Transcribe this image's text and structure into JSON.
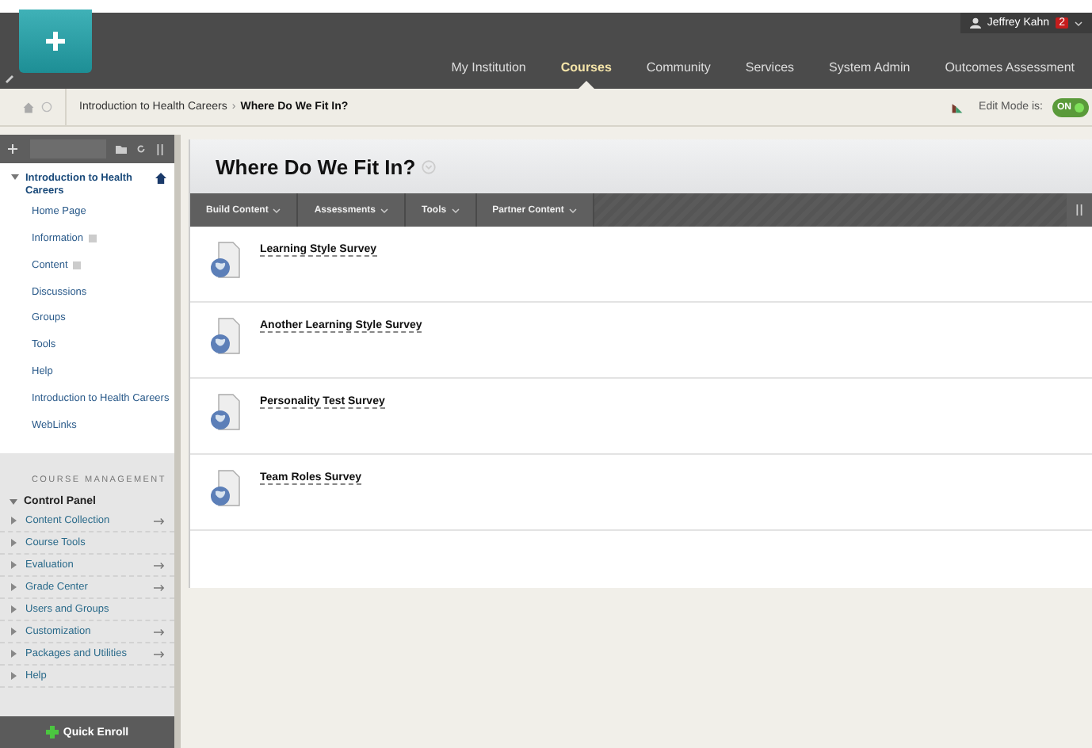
{
  "header": {
    "user": {
      "name": "Jeffrey Kahn",
      "badge": "2"
    },
    "tabs": [
      {
        "label": "My Institution",
        "selected": false
      },
      {
        "label": "Courses",
        "selected": true
      },
      {
        "label": "Community",
        "selected": false
      },
      {
        "label": "Services",
        "selected": false
      },
      {
        "label": "System Admin",
        "selected": false
      },
      {
        "label": "Outcomes Assessment",
        "selected": false
      }
    ]
  },
  "breadcrumb": {
    "items": [
      "Introduction to Health Careers",
      "Where Do We Fit In?"
    ],
    "separator": "›",
    "edit_mode": {
      "label": "Edit Mode is:",
      "value": "ON",
      "on": true
    }
  },
  "course_menu": {
    "title": "Introduction to Health Careers",
    "expanded": true,
    "items": [
      {
        "label": "Home Page",
        "flag": false
      },
      {
        "label": "Information",
        "flag": true
      },
      {
        "label": "Content",
        "flag": true
      },
      {
        "label": "Discussions",
        "flag": false
      },
      {
        "label": "Groups",
        "flag": false
      },
      {
        "label": "Tools",
        "flag": false
      },
      {
        "label": "Help",
        "flag": false
      },
      {
        "label": "Introduction to Health Careers",
        "flag": false
      },
      {
        "label": "WebLinks",
        "flag": false
      }
    ]
  },
  "course_management": {
    "heading": "COURSE MANAGEMENT",
    "control_panel": {
      "label": "Control Panel",
      "expanded": true
    },
    "items": [
      {
        "label": "Content Collection",
        "arrow": true
      },
      {
        "label": "Course Tools",
        "arrow": false
      },
      {
        "label": "Evaluation",
        "arrow": true
      },
      {
        "label": "Grade Center",
        "arrow": true
      },
      {
        "label": "Users and Groups",
        "arrow": false
      },
      {
        "label": "Customization",
        "arrow": true
      },
      {
        "label": "Packages and Utilities",
        "arrow": true
      },
      {
        "label": "Help",
        "arrow": false
      }
    ]
  },
  "quick_enroll": "Quick Enroll",
  "content": {
    "title": "Where Do We Fit In?",
    "action_bar": [
      "Build Content",
      "Assessments",
      "Tools",
      "Partner Content"
    ],
    "items": [
      {
        "title": "Learning Style Survey"
      },
      {
        "title": "Another Learning Style Survey"
      },
      {
        "title": "Personality Test Survey"
      },
      {
        "title": "Team Roles Survey"
      }
    ]
  }
}
